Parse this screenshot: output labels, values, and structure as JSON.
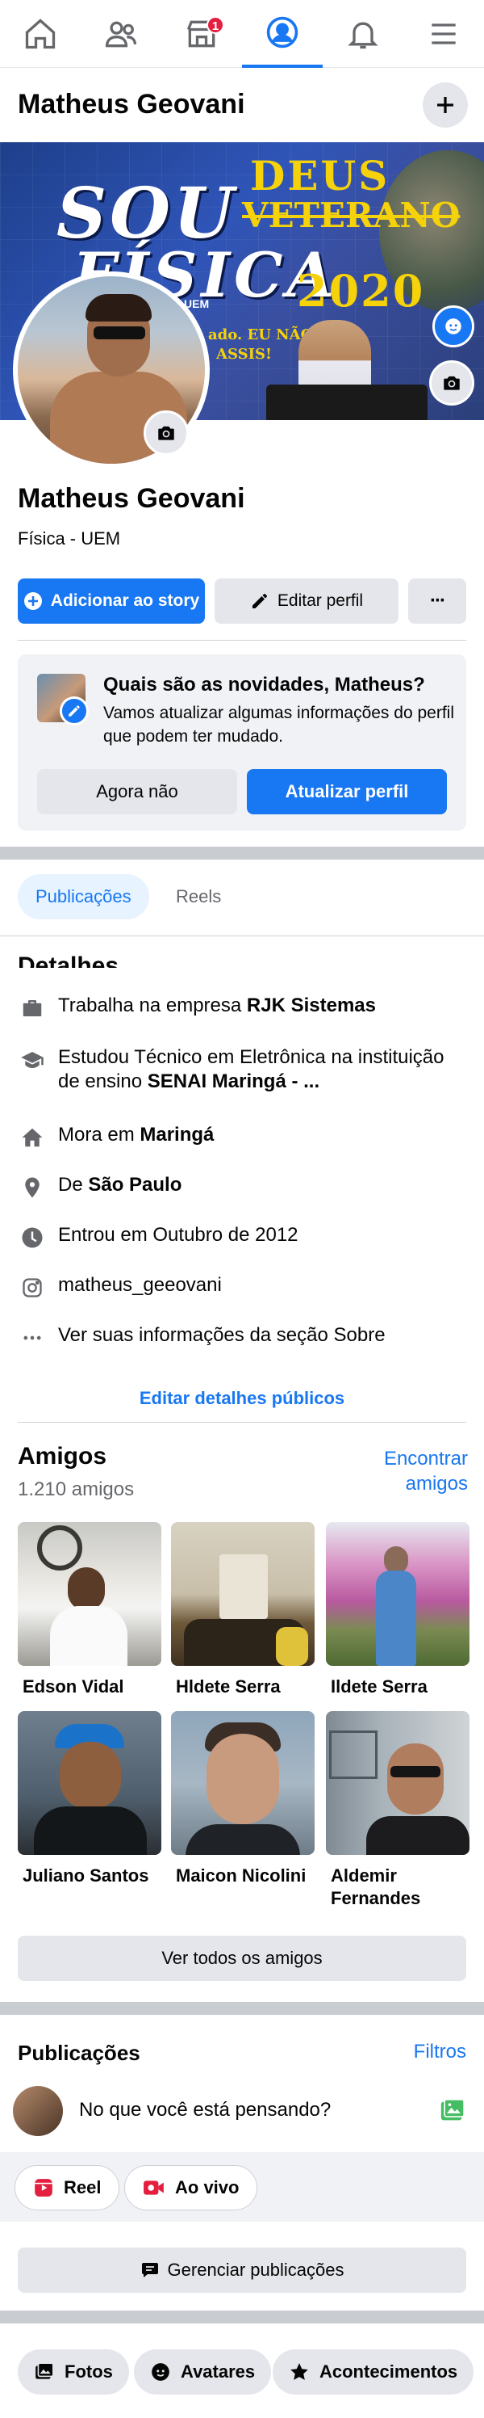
{
  "nav": {
    "notifications_badge": "1"
  },
  "profile": {
    "name": "Matheus Geovani",
    "subtitle": "Física - UEM"
  },
  "cover": {
    "line_sou": "SOU",
    "line_deus": "DEUS",
    "line_veterano": "VETERANO",
    "line_fisica": "FÍSICA",
    "line_year": "2020",
    "line_uem": "UEM",
    "line_small1": "ado. EU NÃO",
    "line_small2": "ASSIS!"
  },
  "actions": {
    "add_story": "Adicionar ao story",
    "edit_profile": "Editar perfil",
    "more": "···"
  },
  "update_card": {
    "title": "Quais são as novidades, Matheus?",
    "text": "Vamos atualizar algumas informações do perfil que podem ter mudado.",
    "not_now": "Agora não",
    "update": "Atualizar perfil"
  },
  "tabs": {
    "posts": "Publicações",
    "reels": "Reels"
  },
  "details": {
    "title": "Detalhes",
    "work_prefix": "Trabalha na empresa ",
    "work_bold": "RJK Sistemas",
    "study_prefix": "Estudou Técnico em Eletrônica na instituição de ensino ",
    "study_bold": "SENAI Maringá - ...",
    "lives_prefix": "Mora em ",
    "lives_bold": "Maringá",
    "from_prefix": "De ",
    "from_bold": "São Paulo",
    "joined": "Entrou em Outubro de 2012",
    "instagram": "matheus_geeovani",
    "about": "Ver suas informações da seção Sobre",
    "edit_public": "Editar detalhes públicos"
  },
  "friends": {
    "title": "Amigos",
    "count": "1.210 amigos",
    "find": "Encontrar amigos",
    "list": [
      {
        "name": "Edson Vidal"
      },
      {
        "name": "Hldete Serra"
      },
      {
        "name": "Ildete Serra"
      },
      {
        "name": "Juliano Santos"
      },
      {
        "name": "Maicon Nicolini"
      },
      {
        "name": "Aldemir Fernandes"
      }
    ],
    "see_all": "Ver todos os amigos"
  },
  "posts": {
    "title": "Publicações",
    "filters": "Filtros",
    "composer_placeholder": "No que você está pensando?",
    "reel": "Reel",
    "live": "Ao vivo",
    "manage": "Gerenciar publicações"
  },
  "bottom_chips": {
    "photos": "Fotos",
    "avatars": "Avatares",
    "events": "Acontecimentos"
  },
  "colors": {
    "accent": "#1877f2",
    "badge": "#e41e3f",
    "grey_button": "#e4e6eb"
  }
}
